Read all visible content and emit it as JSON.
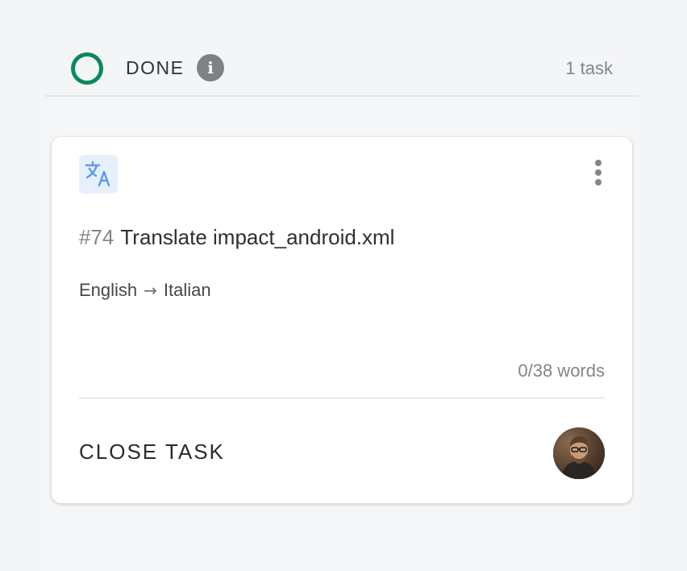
{
  "column": {
    "status_title": "DONE",
    "status_color": "#0a8a5b",
    "info_icon": "info-icon",
    "count_label": "1 task"
  },
  "card": {
    "type_icon": "translate-icon",
    "menu_icon": "more-vertical-icon",
    "task_number": "#74",
    "task_name": "Translate impact_android.xml",
    "source_language": "English",
    "arrow": "→",
    "target_language": "Italian",
    "word_progress": "0/38 words",
    "close_label": "CLOSE TASK",
    "assignee_avatar": "user-avatar"
  },
  "colors": {
    "accent_blue": "#5a9bea",
    "icon_bg": "#e6f0fd",
    "done_green": "#0a8a5b"
  }
}
